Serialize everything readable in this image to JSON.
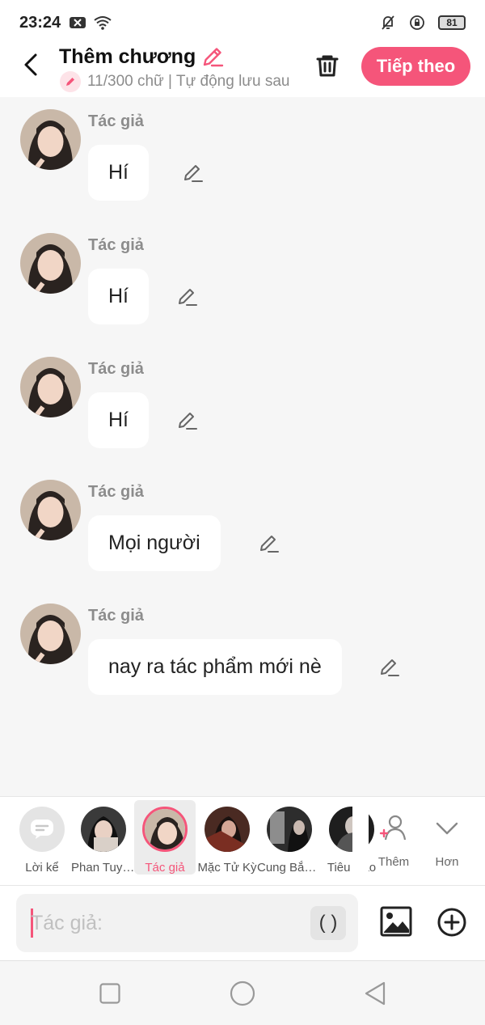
{
  "status_bar": {
    "time": "23:24",
    "battery": "81"
  },
  "header": {
    "title": "Thêm chương",
    "subtitle": "11/300 chữ | Tự động lưu sau",
    "next_label": "Tiếp theo"
  },
  "messages": [
    {
      "author": "Tác giả",
      "text": "Hí"
    },
    {
      "author": "Tác giả",
      "text": "Hí"
    },
    {
      "author": "Tác giả",
      "text": "Hí"
    },
    {
      "author": "Tác giả",
      "text": "Mọi người"
    },
    {
      "author": "Tác giả",
      "text": "nay ra tác phẩm mới nè"
    }
  ],
  "characters": [
    {
      "label": "Lời kể"
    },
    {
      "label": "Phan Tuyết Ninh"
    },
    {
      "label": "Tác giả"
    },
    {
      "label": "Mặc Tử Kỳ"
    },
    {
      "label": "Cung Bắc Lâm"
    },
    {
      "label": "Tiêu Dao"
    }
  ],
  "tray_actions": {
    "add_label": "Thêm",
    "more_label": "Hơn"
  },
  "composer": {
    "placeholder": "Tác giả:",
    "paren_label": "( )"
  },
  "colors": {
    "accent": "#f5557a",
    "background": "#f6f6f6"
  }
}
